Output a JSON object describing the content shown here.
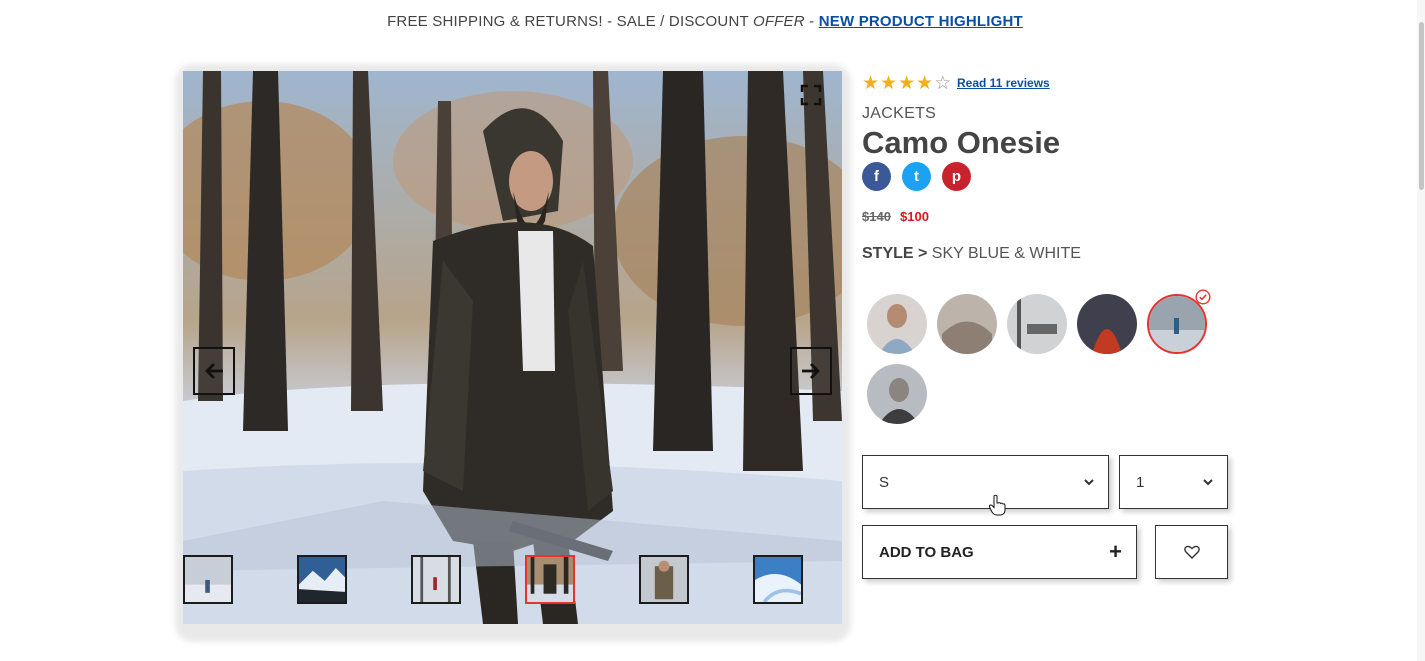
{
  "announcement": {
    "text_1": "FREE SHIPPING & RETURNS! - SALE / DISCOUNT ",
    "text_em": "OFFER",
    "text_2": " - ",
    "link": " NEW PRODUCT HIGHLIGHT"
  },
  "product": {
    "rating": 4,
    "rating_max": 5,
    "reviews_link": "Read 11 reviews",
    "category": "JACKETS",
    "title": "Camo Onesie",
    "price_old": "$140",
    "price_new": "$100",
    "style_label": "STYLE >",
    "style_value": " SKY BLUE & WHITE"
  },
  "social": {
    "facebook_glyph": "f",
    "twitter_glyph": "t",
    "pinterest_glyph": "p"
  },
  "options": {
    "size_value": "S",
    "qty_value": "1",
    "add_to_bag_label": "ADD TO BAG",
    "plus_glyph": "+"
  },
  "icons": {
    "prev": "arrow-left-icon",
    "next": "arrow-right-icon",
    "expand": "expand-icon",
    "wishlist": "heart-icon",
    "selected": "check-circle-icon",
    "chevron": "chevron-down-icon"
  },
  "colors": {
    "accent_red": "#e3342f",
    "link_blue": "#0b4fa0",
    "star_gold": "#f2b01e",
    "sale_red": "#e3121b"
  },
  "gallery": {
    "thumbnail_count": 6,
    "active_thumbnail_index": 3,
    "swatch_count": 6,
    "selected_swatch_index": 4
  }
}
